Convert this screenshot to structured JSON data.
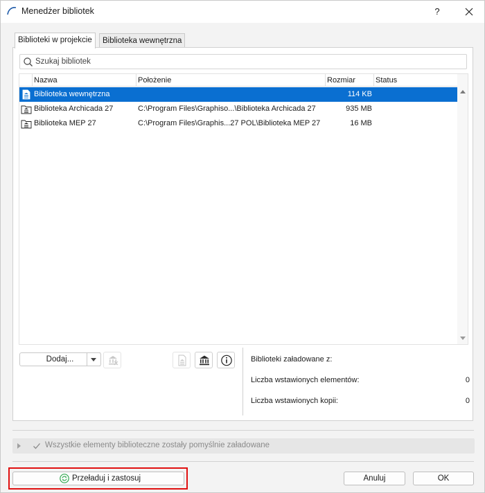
{
  "window": {
    "title": "Menedżer bibliotek",
    "help": "?"
  },
  "tabs": [
    {
      "label": "Biblioteki w projekcie",
      "active": true
    },
    {
      "label": "Biblioteka wewnętrzna",
      "active": false
    }
  ],
  "search": {
    "placeholder": "Szukaj bibliotek",
    "value": ""
  },
  "table": {
    "columns": [
      "Nazwa",
      "Położenie",
      "Rozmiar",
      "Status"
    ],
    "rows": [
      {
        "icon": "library-embedded-icon",
        "name": "Biblioteka wewnętrzna",
        "location": "",
        "size": "114 KB",
        "status": "",
        "selected": true
      },
      {
        "icon": "library-folder-icon",
        "name": "Biblioteka Archicada 27",
        "location": "C:\\Program Files\\Graphiso...\\Biblioteka Archicada 27",
        "size": "935 MB",
        "status": "",
        "selected": false
      },
      {
        "icon": "library-folder-icon",
        "name": "Biblioteka MEP 27",
        "location": "C:\\Program Files\\Graphis...27 POL\\Biblioteka MEP 27",
        "size": "16 MB",
        "status": "",
        "selected": false
      }
    ]
  },
  "actions": {
    "add_label": "Dodaj..."
  },
  "info": {
    "loaded_from_label": "Biblioteki załadowane z:",
    "placed_elements_label": "Liczba wstawionych elementów:",
    "placed_elements_value": "0",
    "placed_copies_label": "Liczba wstawionych kopii:",
    "placed_copies_value": "0"
  },
  "status": {
    "text": "Wszystkie elementy biblioteczne zostały pomyślnie załadowane"
  },
  "footer": {
    "reload_label": "Przeładuj i zastosuj",
    "cancel_label": "Anuluj",
    "ok_label": "OK"
  },
  "colors": {
    "selection": "#0a6fd1",
    "highlight": "#e01010",
    "reload_icon": "#2fa84f"
  }
}
